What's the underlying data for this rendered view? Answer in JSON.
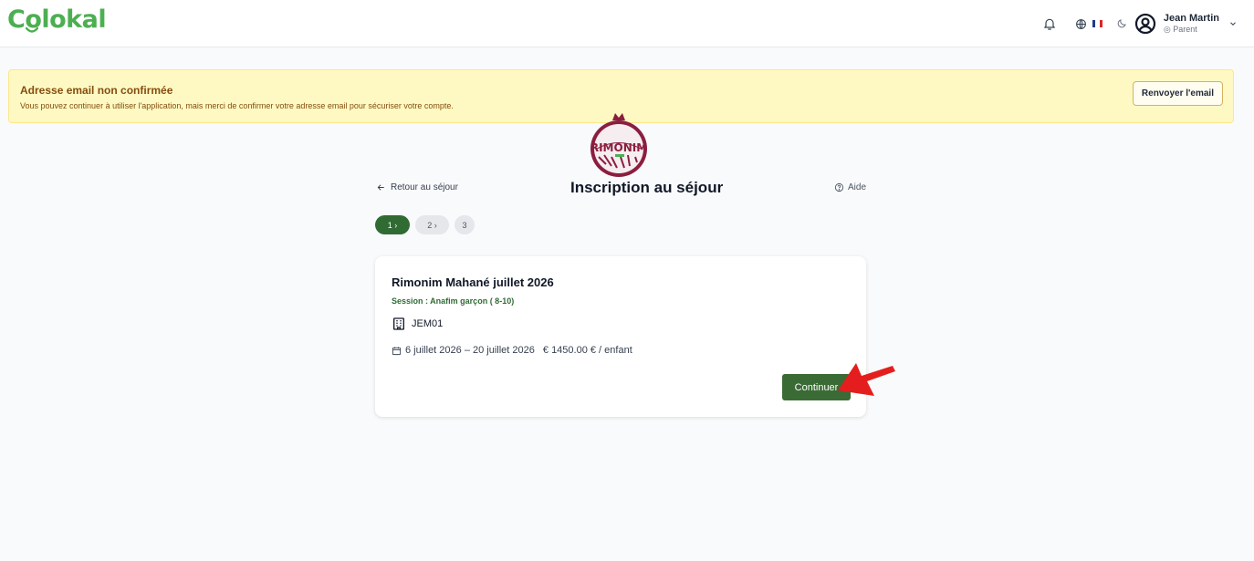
{
  "header": {
    "logo_text": "Colokal",
    "brand_color": "#4caf50",
    "user_name": "Jean Martin",
    "user_role": "Parent"
  },
  "alert": {
    "title": "Adresse email non confirmée",
    "text": "Vous pouvez continuer à utiliser l'application, mais merci de confirmer votre adresse email pour sécuriser votre compte.",
    "button_label": "Renvoyer l'email"
  },
  "emblem": {
    "text": "RIMONIM"
  },
  "page": {
    "back_label": "Retour au séjour",
    "title": "Inscription au séjour",
    "help_label": "Aide"
  },
  "steps": [
    {
      "label": "1 ›",
      "active": true
    },
    {
      "label": "2 ›",
      "active": false
    },
    {
      "label": "3",
      "active": false
    }
  ],
  "card": {
    "title": "Rimonim Mahané juillet 2026",
    "session": "Session : Anafim garçon ( 8-10)",
    "code": "JEM01",
    "dates": "6 juillet 2026 – 20 juillet 2026",
    "price": "€ 1450.00 € / enfant",
    "continue_label": "Continuer"
  },
  "colors": {
    "accent_green": "#2f6b33",
    "alert_bg": "#fef9c3",
    "arrow_red": "#e41e1e"
  },
  "icons": [
    "bell-icon",
    "globe-icon",
    "moon-icon",
    "user-circle-icon",
    "chevron-down-icon",
    "arrow-left-icon",
    "help-circle-icon",
    "building-icon",
    "calendar-icon"
  ]
}
